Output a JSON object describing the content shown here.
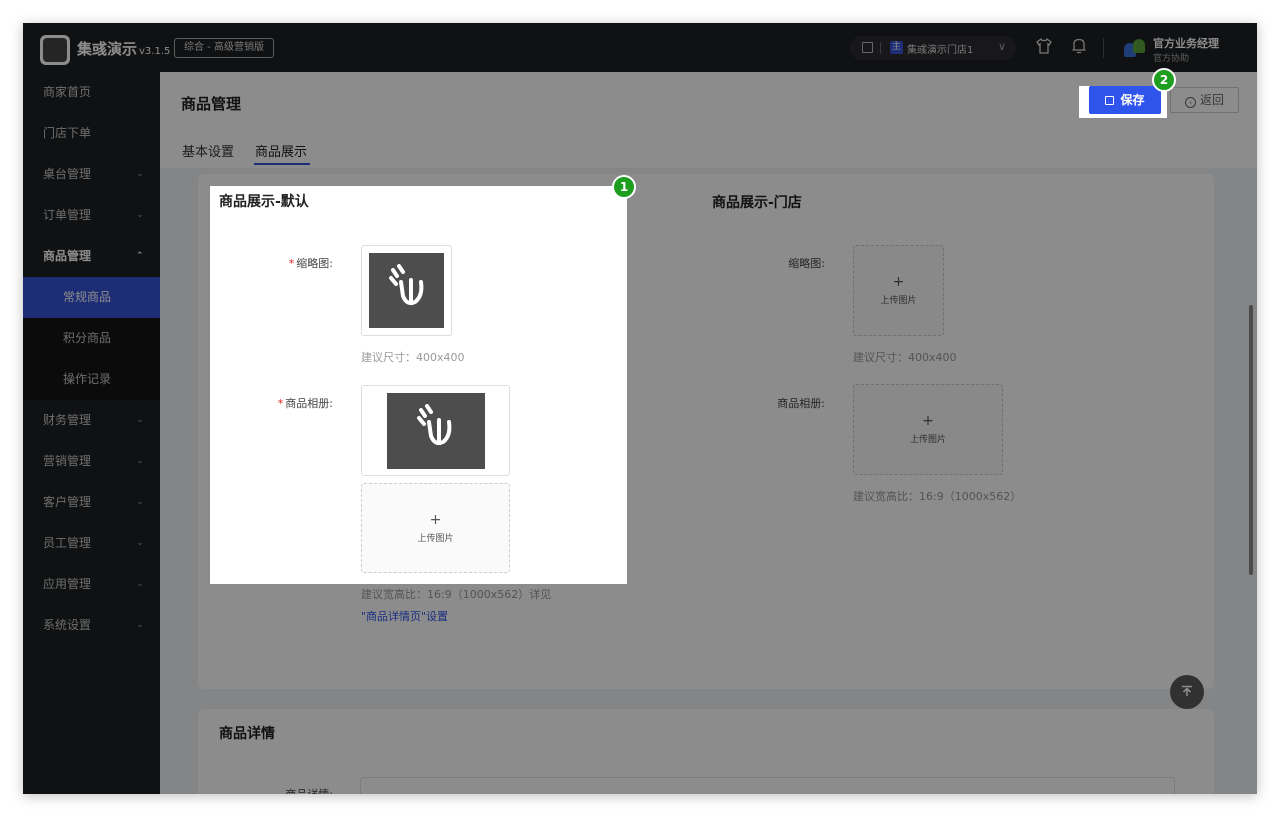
{
  "app": {
    "name": "集彧演示",
    "version": "v3.1.5",
    "edition": "综合 - 高级营销版"
  },
  "topbar": {
    "store_tag": "主",
    "store_name": "集彧演示门店1",
    "user_name": "官方业务经理",
    "user_role": "官方协助"
  },
  "sidebar": {
    "items": [
      {
        "label": "商家首页"
      },
      {
        "label": "门店下单"
      },
      {
        "label": "桌台管理"
      },
      {
        "label": "订单管理"
      },
      {
        "label": "商品管理"
      },
      {
        "label": "常规商品"
      },
      {
        "label": "积分商品"
      },
      {
        "label": "操作记录"
      },
      {
        "label": "财务管理"
      },
      {
        "label": "营销管理"
      },
      {
        "label": "客户管理"
      },
      {
        "label": "员工管理"
      },
      {
        "label": "应用管理"
      },
      {
        "label": "系统设置"
      }
    ]
  },
  "header": {
    "title": "商品管理",
    "tabs": [
      {
        "label": "基本设置"
      },
      {
        "label": "商品展示"
      }
    ],
    "save_label": "保存",
    "back_label": "返回"
  },
  "default_section": {
    "title": "商品展示-默认",
    "thumb_label": "缩略图:",
    "thumb_hint": "建议尺寸：400x400",
    "album_label": "商品相册:",
    "upload_label": "上传图片",
    "album_hint": "建议宽高比：16:9（1000x562）详见",
    "album_link": "\"商品详情页\"设置"
  },
  "store_section": {
    "title": "商品展示-门店",
    "thumb_label": "缩略图:",
    "thumb_hint": "建议尺寸：400x400",
    "album_label": "商品相册:",
    "upload_label": "上传图片",
    "album_hint": "建议宽高比：16:9（1000x562）"
  },
  "detail_section": {
    "title": "商品详情",
    "label": "商品详情:"
  },
  "annotations": {
    "badge1": "1",
    "badge2": "2"
  }
}
